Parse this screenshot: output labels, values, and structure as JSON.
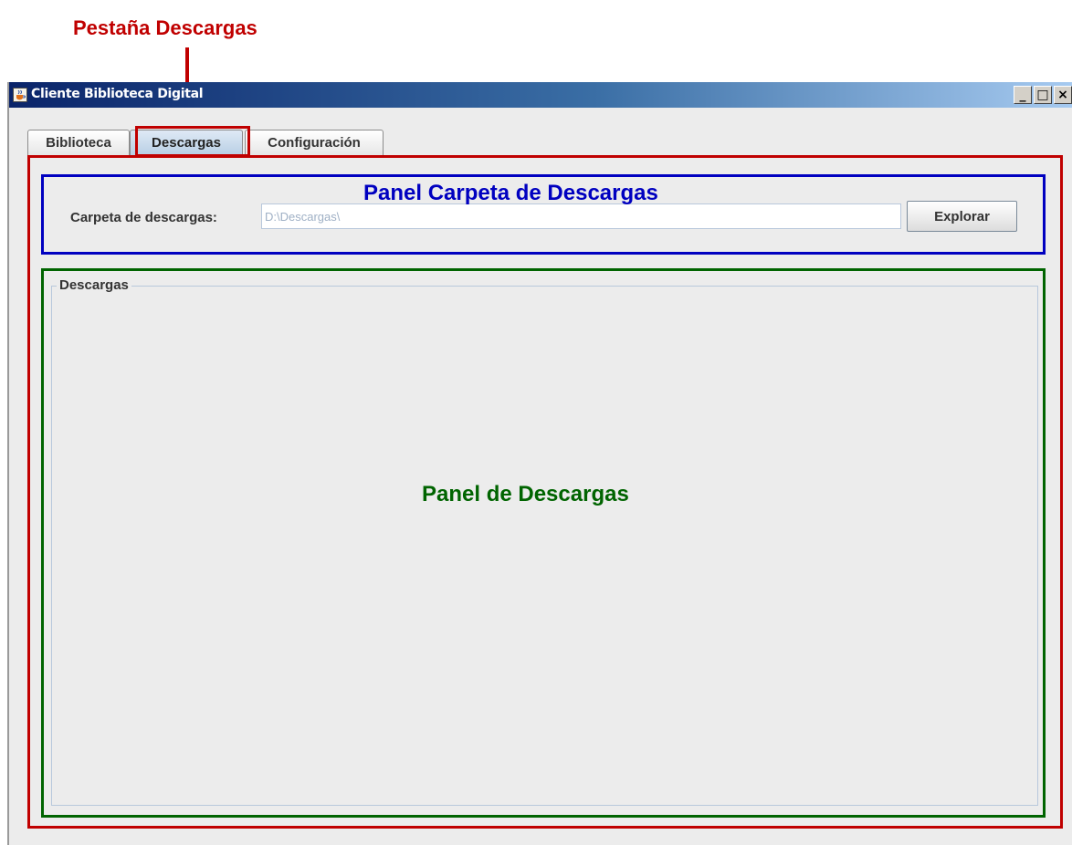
{
  "annotations": {
    "tab_callout": "Pestaña Descargas",
    "folder_panel_label": "Panel Carpeta de Descargas",
    "downloads_panel_label": "Panel de Descargas",
    "colors": {
      "red": "#c00000",
      "blue": "#0000c0",
      "green": "#006400"
    }
  },
  "window": {
    "title": "Cliente Biblioteca Digital",
    "icon": "java-cup-icon",
    "controls": {
      "minimize": "_",
      "maximize": "□",
      "close": "×"
    }
  },
  "tabs": [
    {
      "label": "Biblioteca",
      "selected": false
    },
    {
      "label": "Descargas",
      "selected": true
    },
    {
      "label": "Configuración",
      "selected": false
    }
  ],
  "folder": {
    "label": "Carpeta de descargas:",
    "value": "D:\\Descargas\\",
    "browse_button": "Explorar"
  },
  "downloads": {
    "title": "Descargas"
  }
}
